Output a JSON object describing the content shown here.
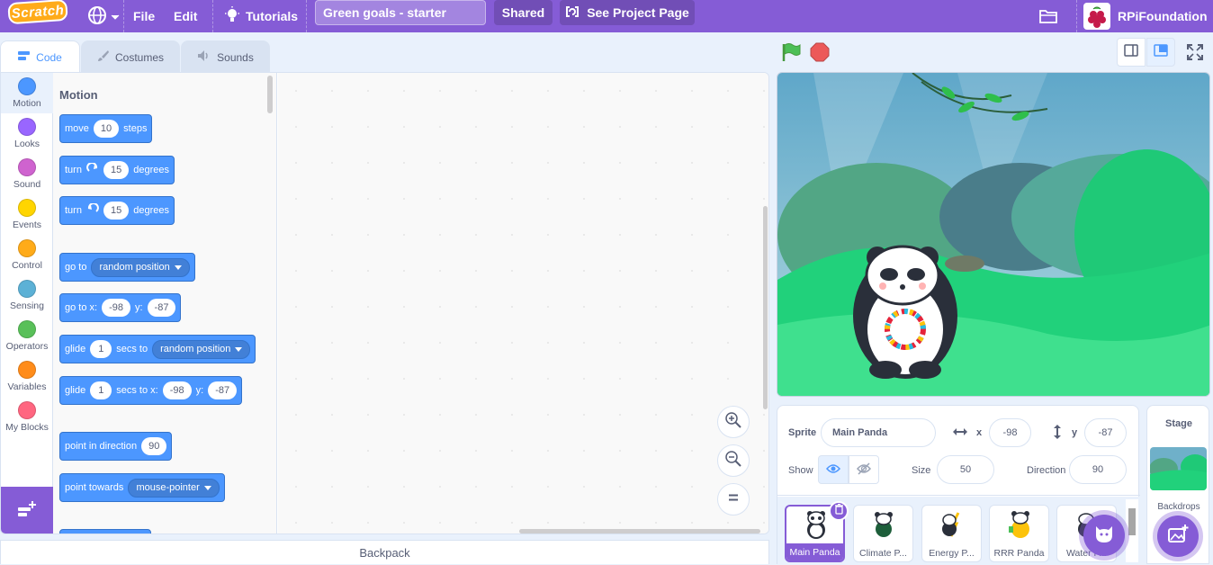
{
  "menubar": {
    "logo": "Scratch",
    "file": "File",
    "edit": "Edit",
    "tutorials": "Tutorials",
    "project_title": "Green goals  - starter",
    "shared": "Shared",
    "see_project": "See Project Page",
    "username": "RPiFoundation"
  },
  "tabs": {
    "code": "Code",
    "costumes": "Costumes",
    "sounds": "Sounds"
  },
  "categories": [
    {
      "label": "Motion",
      "color": "#4c97ff"
    },
    {
      "label": "Looks",
      "color": "#9966ff"
    },
    {
      "label": "Sound",
      "color": "#cf63cf"
    },
    {
      "label": "Events",
      "color": "#ffd500"
    },
    {
      "label": "Control",
      "color": "#ffab19"
    },
    {
      "label": "Sensing",
      "color": "#5cb1d6"
    },
    {
      "label": "Operators",
      "color": "#59c059"
    },
    {
      "label": "Variables",
      "color": "#ff8c1a"
    },
    {
      "label": "My Blocks",
      "color": "#ff6680"
    }
  ],
  "palette": {
    "heading": "Motion",
    "move": {
      "a": "move",
      "n": "10",
      "b": "steps"
    },
    "turn_right": {
      "a": "turn",
      "n": "15",
      "b": "degrees"
    },
    "turn_left": {
      "a": "turn",
      "n": "15",
      "b": "degrees"
    },
    "goto": {
      "a": "go to",
      "menu": "random position"
    },
    "gotoxy": {
      "a": "go to x:",
      "x": "-98",
      "b": "y:",
      "y": "-87"
    },
    "glide": {
      "a": "glide",
      "n": "1",
      "b": "secs to",
      "menu": "random position"
    },
    "glidexy": {
      "a": "glide",
      "n": "1",
      "b": "secs to x:",
      "x": "-98",
      "c": "y:",
      "y": "-87"
    },
    "point_dir": {
      "a": "point in direction",
      "n": "90"
    },
    "point_towards": {
      "a": "point towards",
      "menu": "mouse-pointer"
    }
  },
  "backpack": "Backpack",
  "sprite_info": {
    "sprite_label": "Sprite",
    "sprite_name": "Main Panda",
    "x_label": "x",
    "x": "-98",
    "y_label": "y",
    "y": "-87",
    "show_label": "Show",
    "size_label": "Size",
    "size": "50",
    "direction_label": "Direction",
    "direction": "90"
  },
  "sprites": [
    {
      "name": "Main Panda"
    },
    {
      "name": "Climate P..."
    },
    {
      "name": "Energy P..."
    },
    {
      "name": "RRR Panda"
    },
    {
      "name": "Water P..."
    }
  ],
  "stage_pane": {
    "title": "Stage",
    "backdrops": "Backdrops"
  },
  "colors": {
    "accent": "#855cd6",
    "motion": "#4c97ff",
    "stage_grass": "#1fd27e"
  }
}
